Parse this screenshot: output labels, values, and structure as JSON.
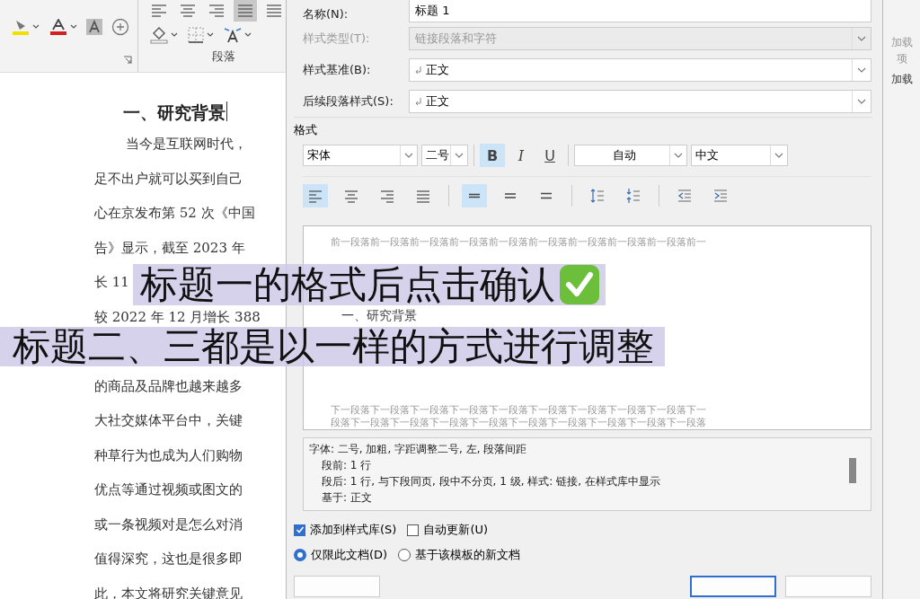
{
  "ribbon": {
    "paragraph_align": [
      {
        "kind": "left",
        "selected": false
      },
      {
        "kind": "center",
        "selected": false
      },
      {
        "kind": "right",
        "selected": false
      },
      {
        "kind": "justify",
        "selected": true
      },
      {
        "kind": "distributed",
        "selected": false
      }
    ],
    "paragraph_label": "段落"
  },
  "document": {
    "heading": "一、研究背景",
    "blocks": [
      {
        "lines": [
          "当今是互联网时代，",
          "足不出户就可以买到自己",
          "心在京发布第 52 次《中国",
          "告》显示，截至 2023 年",
          "长 11",
          "较 2022 年 12 月增长 388"
        ]
      },
      {
        "lines": [
          "的商品及品牌也越来越多",
          "大社交媒体平台中，关键",
          "种草行为也成为人们购物",
          "优点等通过视频或图文的",
          "或一条视频对是怎么对消",
          "值得深究，这也是很多即",
          "此，本文将研究关键意见"
        ]
      }
    ]
  },
  "dialog": {
    "fields": [
      {
        "label": "名称(N):",
        "value": "标题 1",
        "kind": "text",
        "disabled": false
      },
      {
        "label": "样式类型(T):",
        "value": "链接段落和字符",
        "kind": "dropdown",
        "disabled": true
      },
      {
        "label": "样式基准(B):",
        "value": "正文",
        "kind": "dropdown",
        "disabled": false
      },
      {
        "label": "后续段落样式(S):",
        "value": "正文",
        "kind": "dropdown",
        "disabled": false
      }
    ],
    "format_label": "格式",
    "font": "宋体",
    "size": "二号",
    "styles": [
      {
        "kind": "bold",
        "text": "B",
        "selected": true
      },
      {
        "kind": "italic",
        "text": "I",
        "selected": false
      },
      {
        "kind": "underline",
        "text": "U",
        "selected": false
      }
    ],
    "font_color_setting": "自动",
    "language": "中文",
    "align": [
      {
        "kind": "left",
        "selected": true
      },
      {
        "kind": "center",
        "selected": false
      },
      {
        "kind": "right",
        "selected": false
      },
      {
        "kind": "justify",
        "selected": false
      }
    ],
    "spacing": [
      {
        "kind": "single",
        "selected": true
      },
      {
        "kind": "one-half",
        "selected": false
      },
      {
        "kind": "double",
        "selected": false
      }
    ],
    "preview": {
      "before": [
        "前一段落前一段落前一段落前一段落前一段落前一段落前一段落前一段落前一段落前一"
      ],
      "sample": "一、研究背景",
      "after": [
        "下一段落下一段落下一段落下一段落下一段落下一段落下一段落下一段落下一段落下一",
        "段落下一段落下一段落下一段落下一段落下一段落下一段落下一段落下一段落下一段落"
      ]
    },
    "description": [
      "字体: 二号, 加粗, 字距调整二号, 左, 段落间距",
      "段前: 1 行",
      "段后: 1 行, 与下段同页, 段中不分页, 1 级, 样式: 链接, 在样式库中显示",
      "基于: 正文"
    ],
    "checkboxes": [
      {
        "label": "添加到样式库(S)",
        "checked": true
      },
      {
        "label": "自动更新(U)",
        "checked": false
      }
    ],
    "radios": [
      {
        "label": "仅限此文档(D)",
        "selected": true
      },
      {
        "label": "基于该模板的新文档",
        "selected": false
      }
    ]
  },
  "side": {
    "button": "加载项",
    "label": "加载"
  },
  "captions": [
    "标题一的格式后点击确认",
    "标题二、三都是以一样的方式进行调整"
  ]
}
